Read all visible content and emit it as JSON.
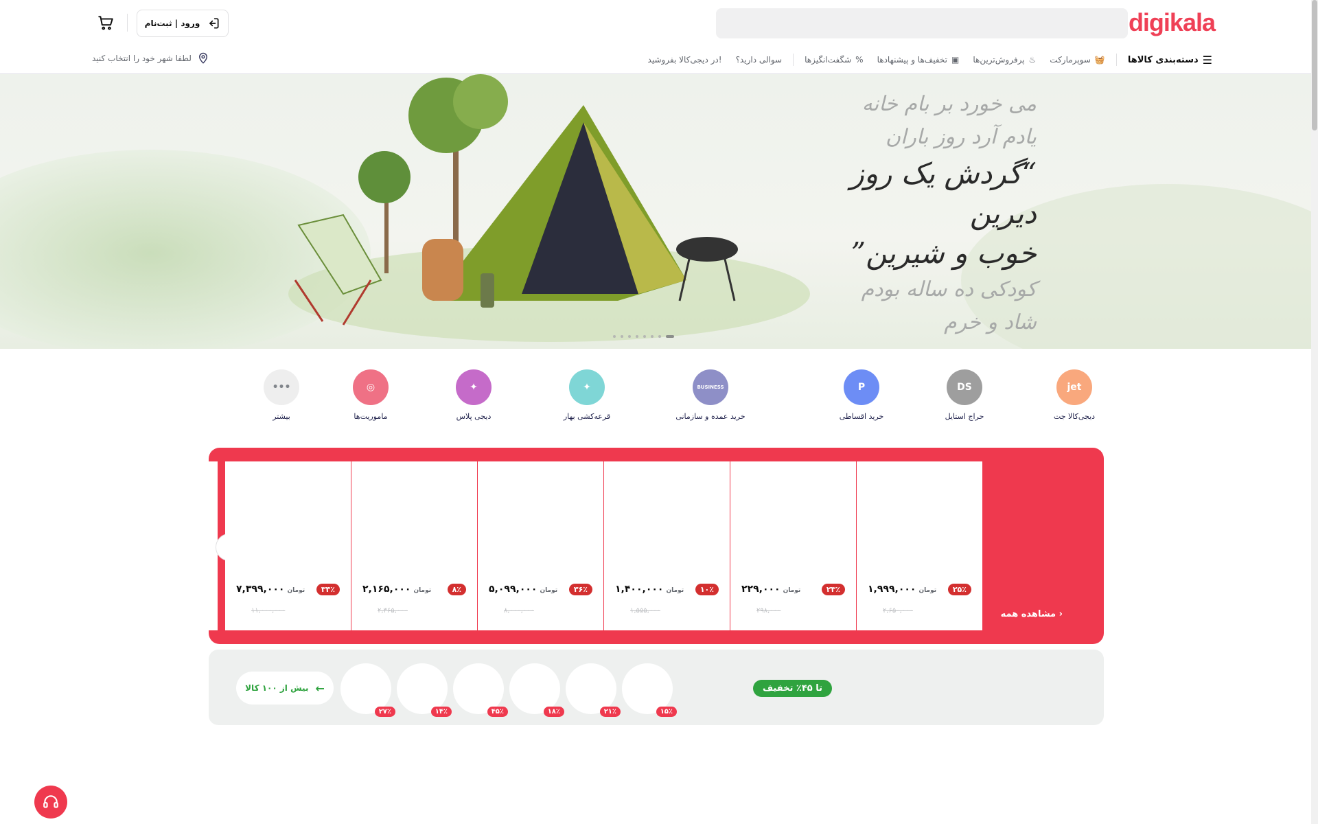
{
  "header": {
    "logo": "digikala",
    "search_placeholder": "",
    "login_label": "ورود | ثبت‌نام",
    "city_label": "لطفا شهر خود را انتخاب کنید"
  },
  "nav": {
    "categories": "دسته‌بندی کالاها",
    "items": [
      "سوپرمارکت",
      "پرفروش‌ترین‌ها",
      "تخفیف‌ها و پیشنهادها",
      "شگفت‌انگیزها",
      "سوالی دارید؟",
      "در دیجی‌کالا بفروشید!"
    ]
  },
  "banner": {
    "lines": [
      "می خورد بر بام خانه",
      "یادم آرد روز باران",
      "“گردش یک روز دیرین",
      "خوب و شیرین”",
      "کودکی ده ساله بودم",
      "شاد و خرم"
    ]
  },
  "shortcuts": [
    {
      "label": "دیجی‌کالا جت",
      "icon": "jet-icon",
      "color": "#f9a87d",
      "glyph": "jet"
    },
    {
      "label": "حراج استایل",
      "icon": "style-sale-icon",
      "color": "#9e9e9e",
      "glyph": "DS"
    },
    {
      "label": "خرید اقساطی",
      "icon": "installment-icon",
      "color": "#6d8df5",
      "glyph": "P"
    },
    {
      "label": "خرید عمده و سازمانی",
      "icon": "business-icon",
      "color": "#8e8fc7",
      "glyph": "BUSINESS"
    },
    {
      "label": "قرعه‌کشی بهار",
      "icon": "lottery-icon",
      "color": "#7fd6d6",
      "glyph": "✦"
    },
    {
      "label": "دیجی پلاس",
      "icon": "digiplus-icon",
      "color": "#c56bc9",
      "glyph": "✦"
    },
    {
      "label": "ماموریت‌ها",
      "icon": "missions-icon",
      "color": "#ef7185",
      "glyph": "◎"
    },
    {
      "label": "بیشتر",
      "icon": "more-icon",
      "color": "#eeeeee",
      "glyph": "•••"
    }
  ],
  "amazing": {
    "see_all": "مشاهده همه",
    "currency": "تومان",
    "products": [
      {
        "discount": "۲۵٪",
        "price": "۱,۹۹۹,۰۰۰",
        "old_price": "۲,۶۵۰,۰۰۰"
      },
      {
        "discount": "۲۳٪",
        "price": "۲۲۹,۰۰۰",
        "old_price": "۲۹۸,۰۰۰"
      },
      {
        "discount": "۱۰٪",
        "price": "۱,۴۰۰,۰۰۰",
        "old_price": "۱,۵۵۵,۰۰۰"
      },
      {
        "discount": "۳۶٪",
        "price": "۵,۰۹۹,۰۰۰",
        "old_price": "۸,۰۰۰,۰۰۰"
      },
      {
        "discount": "۸٪",
        "price": "۲,۱۶۵,۰۰۰",
        "old_price": "۲,۳۶۵,۰۰۰"
      },
      {
        "discount": "۳۳٪",
        "price": "۷,۳۹۹,۰۰۰",
        "old_price": "۱۱,۰۰۰,۰۰۰"
      }
    ]
  },
  "fresh": {
    "badge": "تا ۴۵٪ تخفیف",
    "more_label": "بیش از ۱۰۰ کالا",
    "discounts": [
      "۱۵٪",
      "۲۱٪",
      "۱۸٪",
      "۴۵٪",
      "۱۴٪",
      "۲۷٪"
    ]
  }
}
